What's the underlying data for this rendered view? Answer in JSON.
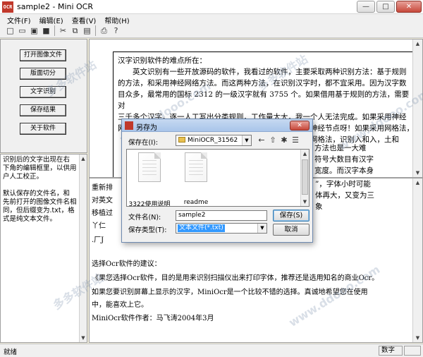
{
  "window": {
    "icon_text": "OCR",
    "title": "sample2 - Mini OCR",
    "min": "—",
    "max": "□",
    "close": "✕"
  },
  "menu": [
    "文件(F)",
    "编辑(E)",
    "查看(V)",
    "帮助(H)"
  ],
  "toolbar": {
    "icons": [
      "new-file-icon",
      "open-folder-icon",
      "open-image-icon",
      "save-icon",
      "cut-icon",
      "copy-icon",
      "paste-icon",
      "print-icon",
      "help-icon"
    ],
    "glyphs": [
      "□",
      "▭",
      "▣",
      "■",
      "✂",
      "⧉",
      "▤",
      "⎙",
      "?"
    ]
  },
  "side_buttons": [
    "打开图像文件",
    "版面切分",
    "文字识别",
    "保存结果",
    "关于软件"
  ],
  "left_text": {
    "lines": [
      "识别后的文字出现在右",
      "下角的编辑框里，以供用",
      "户人工校正。",
      "",
      "默认保存的文件名，和",
      "先前打开的图像文件名相",
      "同，但后缀变为.txt，格",
      "式是纯文本文件。"
    ]
  },
  "doc": {
    "lines": [
      "汉字识别软件的难点所在：",
      "　　英文识别有一些开放源码的软件，我看过的软件，主要采取两种识别方法：基于规则",
      "的方法，和采用神经网络方法。而这两种方法，在识别汉字时，都不宜采用。因为汉字数",
      "目众多，最常用的国标 2312 的一级汉字就有 3755 个。如果借用基于规则的方法，需要对",
      "三千多个汉字，逐一人工写出分类规则，工作量太大，我一个人无法完成。如果采用神经",
      "网络的方法，这么多汉字，我不敢想象，需要多少层网络和神经节点呀！如果采用网格法，",
      "　　　　　　　　　　　　　　较好的效果走来，而采用了网格法，识别入和入，土和"
    ],
    "right_fragments": [
      "方法也是一大难",
      "符号大数目有汉字",
      "宽度。而汉字本身",
      "”，字体小时可能",
      "体再大，又变为三",
      "象"
    ]
  },
  "lower": {
    "partial_lines": [
      "重新排",
      "对英文",
      "移植过",
      "丫仁",
      ".厂J"
    ],
    "lines": [
      "选择Ocr软件的建议：",
      "《果您选择Ocr软件，目的是用来识别扫描仪出来打印字体，推荐还是选用知名的商业Ocr。",
      "如果您要识别屏幕上显示的汉字，MiniOcr是一个比较不错的选择。真诚地希望您在使用",
      "中，能喜欢上它。",
      "MiniOcr软件作者：马飞涛2004年3月"
    ]
  },
  "status": {
    "left": "就绪",
    "right": "数字"
  },
  "dialog": {
    "title": "另存为",
    "close": "✕",
    "save_in_label": "保存在(I):",
    "folder": "MiniOCR_31562",
    "nav_icons": [
      "back-icon",
      "up-folder-icon",
      "new-folder-icon",
      "view-menu-icon"
    ],
    "nav_glyphs": [
      "←",
      "⇧",
      "✱",
      "☰"
    ],
    "files": [
      "3322使用说明",
      "readme"
    ],
    "filename_label": "文件名(N):",
    "filename": "sample2",
    "filetype_label": "保存类型(T):",
    "filetype": "文本文件(*.txt)",
    "save_button": "保存(S)",
    "cancel_button": "取消"
  },
  "watermarks": [
    "多多软件站",
    "www.ddooo.com",
    "多多软件站",
    "www.ddooo.com",
    "多多软件站",
    "www.ddooo.com"
  ]
}
